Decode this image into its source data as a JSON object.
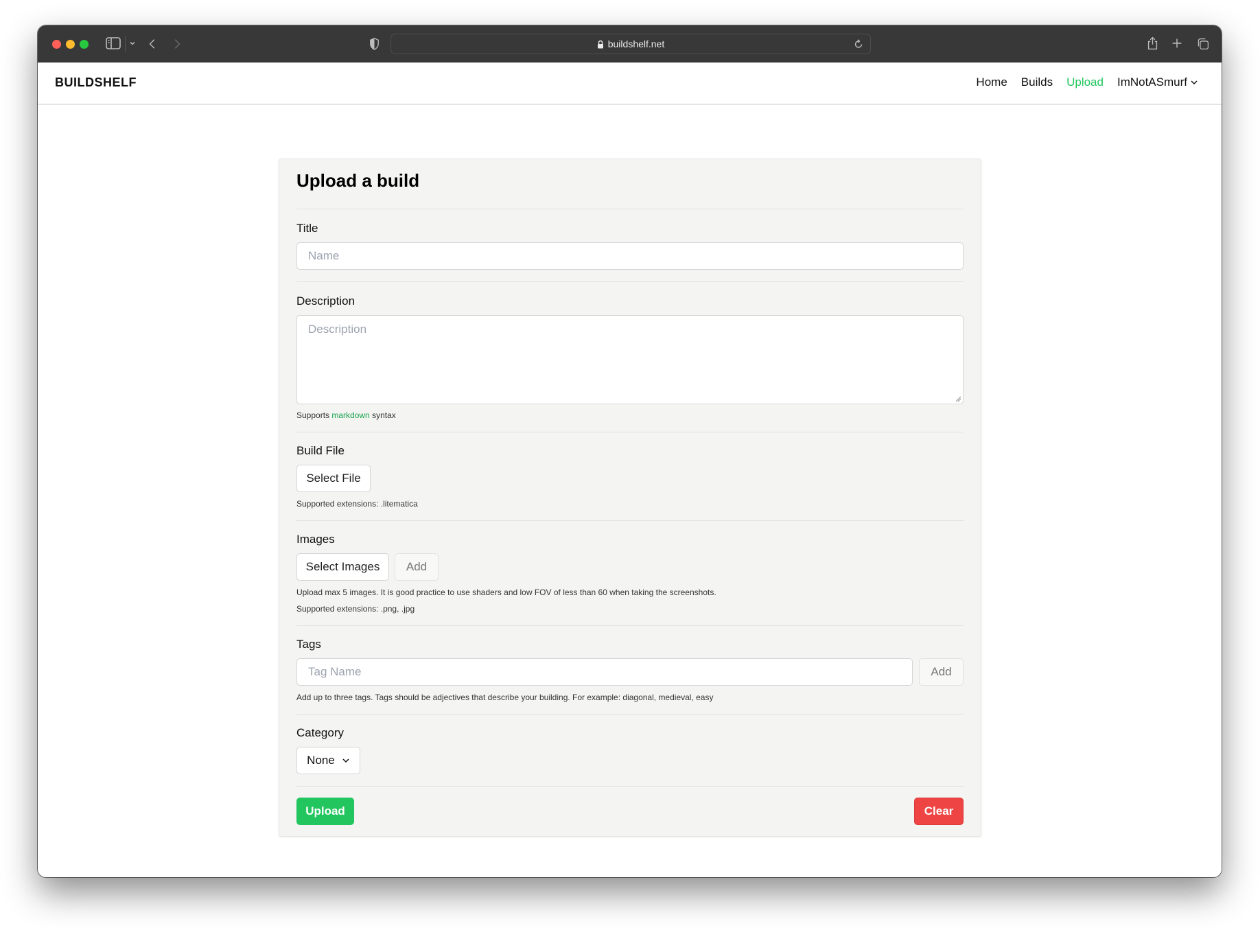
{
  "browser": {
    "url": "buildshelf.net",
    "icons": {
      "sidebar": "sidebar-toggle-icon",
      "tab_menu": "chevron-down-icon",
      "back": "chevron-left-icon",
      "forward": "chevron-right-icon",
      "privacy": "shield-icon",
      "lock": "lock-icon",
      "reload": "reload-icon",
      "share": "share-icon",
      "new_tab": "plus-icon",
      "tab_overview": "tabs-icon"
    }
  },
  "header": {
    "brand": "BUILDSHELF",
    "nav": [
      {
        "label": "Home",
        "active": false
      },
      {
        "label": "Builds",
        "active": false
      },
      {
        "label": "Upload",
        "active": true
      }
    ],
    "user": "ImNotASmurf"
  },
  "form": {
    "heading": "Upload a build",
    "title": {
      "label": "Title",
      "value": "",
      "placeholder": "Name"
    },
    "description": {
      "label": "Description",
      "value": "",
      "placeholder": "Description",
      "help_prefix": "Supports",
      "help_link": "markdown",
      "help_suffix": "syntax"
    },
    "build_file": {
      "label": "Build File",
      "button": "Select File",
      "help": "Supported extensions: .litematica"
    },
    "images": {
      "label": "Images",
      "select_button": "Select Images",
      "add_button": "Add",
      "help_1": "Upload max 5 images. It is good practice to use shaders and low FOV of less than 60 when taking the screenshots.",
      "help_2": "Supported extensions: .png, .jpg"
    },
    "tags": {
      "label": "Tags",
      "value": "",
      "placeholder": "Tag Name",
      "add_button": "Add",
      "help": "Add up to three tags. Tags should be adjectives that describe your building. For example: diagonal, medieval, easy"
    },
    "category": {
      "label": "Category",
      "selected": "None"
    },
    "actions": {
      "upload": "Upload",
      "clear": "Clear"
    }
  },
  "colors": {
    "accent": "#22c55e",
    "danger": "#ef4444",
    "link": "#16a34a",
    "card_bg": "#f4f4f3",
    "toolbar_bg": "#383838"
  }
}
